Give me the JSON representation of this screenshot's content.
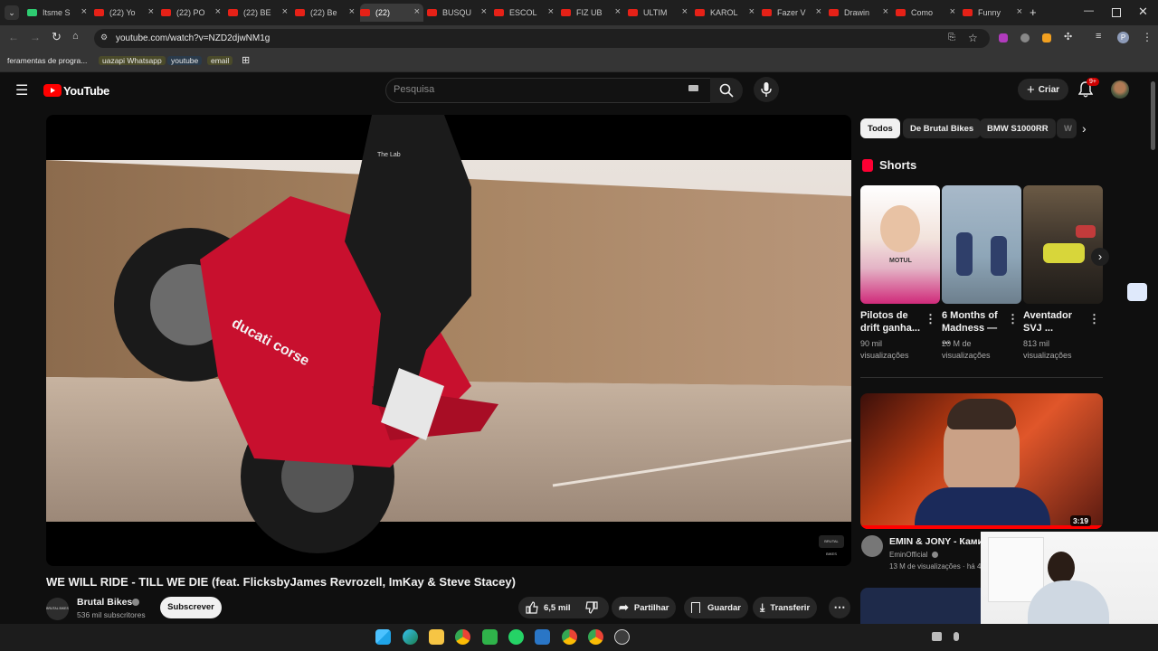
{
  "browser": {
    "tabs": [
      {
        "label": "Itsme S"
      },
      {
        "label": "(22) Yo"
      },
      {
        "label": "(22) PO"
      },
      {
        "label": "(22) BE"
      },
      {
        "label": "(22) Be"
      },
      {
        "label": "(22)"
      },
      {
        "label": "BUSQU"
      },
      {
        "label": "ESCOL"
      },
      {
        "label": "FIZ UB"
      },
      {
        "label": "ULTIM"
      },
      {
        "label": "KAROL"
      },
      {
        "label": "Fazer V"
      },
      {
        "label": "Drawin"
      },
      {
        "label": "Como"
      },
      {
        "label": "Funny"
      }
    ],
    "new_tab": "+",
    "url": "youtube.com/watch?v=NZD2djwNM1g",
    "bookmarks": [
      "feramentas de progra...",
      "uazapi Whatsapp",
      "youtube",
      "email"
    ]
  },
  "header": {
    "logo": "YouTube",
    "search_placeholder": "Pesquisa",
    "create_label": "Criar",
    "notif_badge": "9+"
  },
  "video": {
    "title": "WE WILL RIDE - TILL WE DIE (feat. FlicksbyJames Revrozell, ImKay & Steve Stacey)",
    "bike_text": "ducati corse",
    "rider_text": "The Lab",
    "watermark": "BRUTAL BIKES"
  },
  "channel": {
    "name": "Brutal Bikes",
    "subscribers": "536 mil subscritores",
    "subscribe_label": "Subscrever",
    "avatar_text": "BRUTAL BIKES"
  },
  "actions": {
    "likes": "6,5 mil",
    "share": "Partilhar",
    "save": "Guardar",
    "download": "Transferir"
  },
  "chips": [
    "Todos",
    "De Brutal Bikes",
    "BMW S1000RR",
    "W"
  ],
  "shorts": {
    "heading": "Shorts",
    "items": [
      {
        "title": "Pilotos de drift ganha...",
        "views": "90 mil visualizações",
        "thumb_text": "MOTUL"
      },
      {
        "title": "6 Months of Madness — ...",
        "views": "20 M de visualizações"
      },
      {
        "title": "Aventador SVJ ...",
        "views": "813 mil visualizações"
      }
    ]
  },
  "recommended": {
    "duration": "3:19",
    "title": "EMIN & JONY - Камин",
    "channel": "EminOfficial",
    "meta": "13 M de visualizações · há 4"
  },
  "colors": {
    "brand_red": "#ff0000",
    "background": "#0f0f0f",
    "chip_bg": "#272727"
  }
}
